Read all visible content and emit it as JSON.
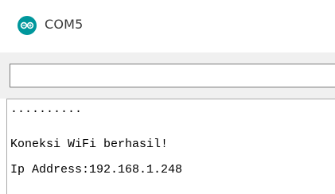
{
  "window": {
    "title": "COM5",
    "icon": "arduino-logo-icon"
  },
  "input": {
    "value": "",
    "placeholder": ""
  },
  "output": {
    "lines": [
      "..........",
      "Koneksi WiFi berhasil!",
      "Ip Address:192.168.1.248"
    ]
  },
  "colors": {
    "accent": "#00979c",
    "panel": "#f0f0f0"
  }
}
